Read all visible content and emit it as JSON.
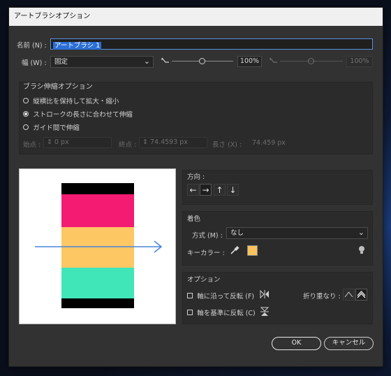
{
  "window": {
    "title": "アートブラシオプション"
  },
  "name": {
    "label": "名前 (N) :",
    "value": "アートブラシ 1"
  },
  "width": {
    "label": "幅 (W) :",
    "select_value": "固定",
    "value1": "100%",
    "value2": "100%"
  },
  "scale_group": {
    "title": "ブラシ伸縮オプション",
    "options": [
      "縦横比を保持して拡大・縮小",
      "ストロークの長さに合わせて伸縮",
      "ガイド間で伸縮"
    ],
    "selected_index": 1,
    "start_label": "始点 :",
    "start_value": "0 px",
    "end_label": "終点 :",
    "end_value": "74.4593 px",
    "length_label": "長さ (X) :",
    "length_value": "74.459 px"
  },
  "direction": {
    "title": "方向 :",
    "arrows": [
      "←",
      "→",
      "↑",
      "↓"
    ],
    "selected_index": 1
  },
  "colorize": {
    "title": "着色",
    "method_label": "方式 (M) :",
    "method_value": "なし",
    "key_color_label": "キーカラー :",
    "key_color": "#f9c25c"
  },
  "options": {
    "title": "オプション",
    "flip_along": "軸に沿って反転 (F)",
    "flip_across": "軸を基準に反転 (C)",
    "overlap_label": "折り重なり :"
  },
  "buttons": {
    "ok": "OK",
    "cancel": "キャンセル"
  },
  "preview": {
    "stripe_colors": [
      "#000000",
      "#f41b73",
      "#fdc764",
      "#fdc764",
      "#41e6b8",
      "#000000"
    ],
    "arrow_color": "#4a86d8"
  }
}
